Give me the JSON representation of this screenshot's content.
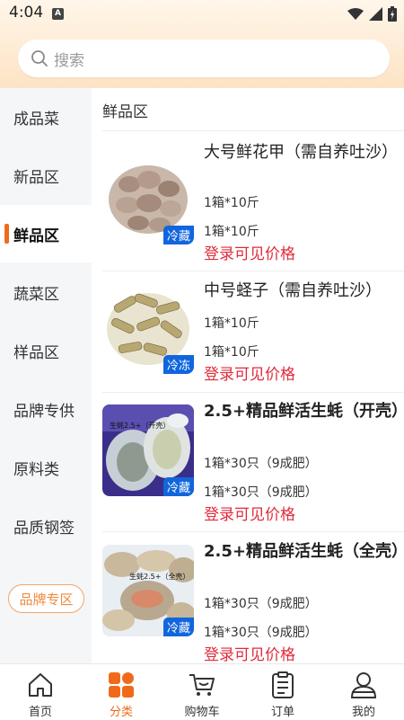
{
  "status_bar": {
    "time": "4:04",
    "badge": "A"
  },
  "search": {
    "placeholder": "搜索"
  },
  "sidebar": {
    "items": [
      {
        "label": "成品菜"
      },
      {
        "label": "新品区"
      },
      {
        "label": "鲜品区",
        "active": true
      },
      {
        "label": "蔬菜区"
      },
      {
        "label": "样品区"
      },
      {
        "label": "品牌专供"
      },
      {
        "label": "原料类"
      },
      {
        "label": "品质钢签"
      }
    ],
    "brand_button": "品牌专区"
  },
  "main": {
    "section_title": "鲜品区",
    "products": [
      {
        "name": "大号鲜花甲（需自养吐沙）",
        "spec1": "1箱*10斤",
        "spec2": "1箱*10斤",
        "price": "登录可见价格",
        "badge": "冷藏",
        "bold": false
      },
      {
        "name": "中号蛏子（需自养吐沙）",
        "spec1": "1箱*10斤",
        "spec2": "1箱*10斤",
        "price": "登录可见价格",
        "badge": "冷冻",
        "bold": false
      },
      {
        "name": "2.5+精品鲜活生蚝（开壳）",
        "spec1": "1箱*30只（9成肥）",
        "spec2": "1箱*30只（9成肥）",
        "price": "登录可见价格",
        "badge": "冷藏",
        "bold": true,
        "photo_label": "生蚝2.5+（开壳）"
      },
      {
        "name": "2.5+精品鲜活生蚝（全壳）",
        "spec1": "1箱*30只（9成肥）",
        "spec2": "1箱*30只（9成肥）",
        "price": "登录可见价格",
        "badge": "冷藏",
        "bold": true,
        "photo_label": "生蚝2.5+（全壳）"
      }
    ]
  },
  "tabbar": {
    "tabs": [
      {
        "label": "首页",
        "icon": "home-icon"
      },
      {
        "label": "分类",
        "icon": "category-icon",
        "active": true
      },
      {
        "label": "购物车",
        "icon": "cart-icon"
      },
      {
        "label": "订单",
        "icon": "order-icon"
      },
      {
        "label": "我的",
        "icon": "user-icon"
      }
    ]
  },
  "colors": {
    "accent": "#f06a1c",
    "price": "#e02b3c",
    "badge": "#1166dd"
  }
}
